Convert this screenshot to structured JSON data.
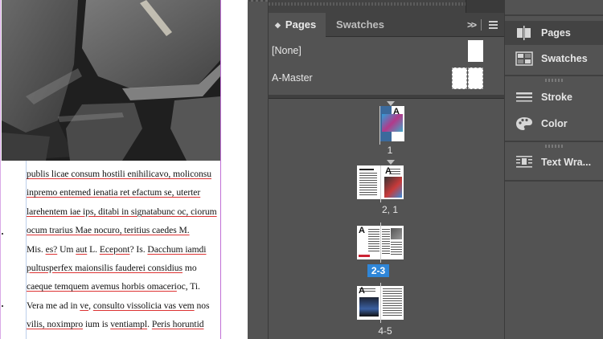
{
  "document": {
    "body_lines": [
      [
        {
          "t": "publis licae consum hostili enihilicavo, moliconsu",
          "u": true
        }
      ],
      [
        {
          "t": "inpremo entemed ienatia ret efactum se, uterter",
          "u": true
        }
      ],
      [
        {
          "t": "larehentem iae ips, ditabi in signatabunc oc, ciorum",
          "u": true
        }
      ],
      [
        {
          "t": "ocum trarius Mae nocuro, teritius caedes M.",
          "u": true
        }
      ],
      [
        {
          "t": "Mis. ",
          "u": false
        },
        {
          "t": "es?",
          "u": true
        },
        {
          "t": " Um ",
          "u": false
        },
        {
          "t": "aut",
          "u": true
        },
        {
          "t": " L. ",
          "u": false
        },
        {
          "t": "Ecepont",
          "u": true
        },
        {
          "t": "? Is. ",
          "u": false
        },
        {
          "t": "Dacchum iamdi",
          "u": true
        }
      ],
      [
        {
          "t": "pultusperfex maionsilis fauderei considius",
          "u": true
        },
        {
          "t": " mo",
          "u": false
        }
      ],
      [
        {
          "t": "caeque temquem avemus horbis omaceri",
          "u": true
        },
        {
          "t": "oc, Ti.",
          "u": false
        }
      ],
      [
        {
          "t": "Vera me ad in ",
          "u": false
        },
        {
          "t": "ve",
          "u": true
        },
        {
          "t": ", ",
          "u": false
        },
        {
          "t": "consulto vissolicia vas vem",
          "u": true
        },
        {
          "t": " nos",
          "u": false
        }
      ],
      [
        {
          "t": "vilis, noximpro",
          "u": true
        },
        {
          "t": " ium is ",
          "u": false
        },
        {
          "t": "ventiampl",
          "u": true
        },
        {
          "t": ". ",
          "u": false
        },
        {
          "t": "Peris horuntid",
          "u": true
        }
      ]
    ]
  },
  "pages_panel": {
    "tabs": [
      {
        "label": "Pages",
        "active": true
      },
      {
        "label": "Swatches",
        "active": false
      }
    ],
    "more_icon": "double-chevron-right",
    "menu_icon": "hamburger-menu",
    "masters": [
      {
        "label": "[None]"
      },
      {
        "label": "A-Master"
      }
    ],
    "pages": [
      {
        "label": "1",
        "selected": false,
        "master_prefix": "A"
      },
      {
        "label": "2, 1",
        "selected": false,
        "master_prefix": "A"
      },
      {
        "label": "2-3",
        "selected": true,
        "master_prefix": "A"
      },
      {
        "label": "4-5",
        "selected": false,
        "master_prefix": "A"
      }
    ]
  },
  "dock": {
    "items": [
      {
        "label": "Pages",
        "icon": "pages-icon"
      },
      {
        "label": "Swatches",
        "icon": "swatches-icon"
      },
      {
        "label": "Stroke",
        "icon": "stroke-icon"
      },
      {
        "label": "Color",
        "icon": "color-palette-icon"
      },
      {
        "label": "Text Wra...",
        "icon": "text-wrap-icon"
      }
    ]
  },
  "colors": {
    "selection": "#2f86d8",
    "panel_bg": "#535353",
    "tab_bar_bg": "#434343",
    "margin_guide": "#c06fd6",
    "spellcheck_underline": "#dd3333"
  }
}
